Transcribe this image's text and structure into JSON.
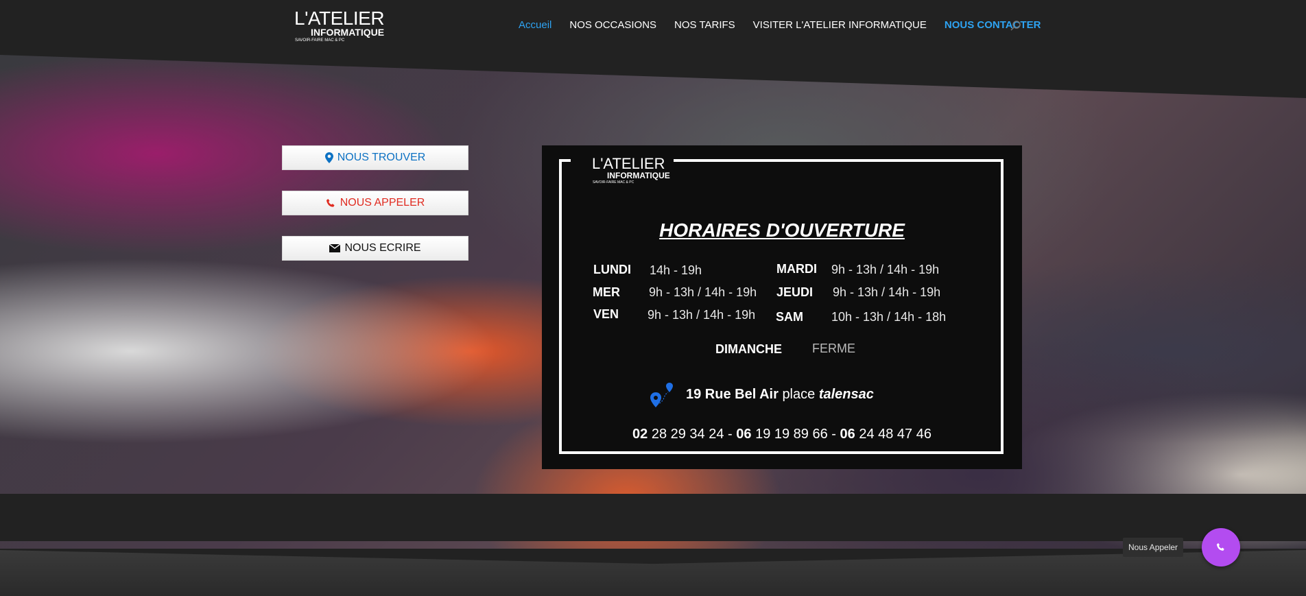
{
  "header": {
    "logo": {
      "line1": "L'ATELIER",
      "line2": "INFORMATIQUE",
      "line3": "SAVOIR-FAIRE MAC & PC"
    },
    "nav": [
      {
        "label": "Accueil"
      },
      {
        "label": "NOS OCCASIONS"
      },
      {
        "label": "NOS TARIFS"
      },
      {
        "label": "VISITER L'ATELIER INFORMATIQUE"
      },
      {
        "label": "NOUS CONTACTER"
      }
    ],
    "search_icon": "search-icon"
  },
  "cta": {
    "find": {
      "label": "NOUS TROUVER",
      "icon": "map-pin-icon",
      "color": "#0c71c3"
    },
    "call": {
      "label": "NOUS APPELER",
      "icon": "phone-icon",
      "color": "#e02b20"
    },
    "write": {
      "label": "NOUS ECRIRE",
      "icon": "envelope-icon",
      "color": "#111111"
    }
  },
  "schedule": {
    "logo": {
      "line1": "L'ATELIER",
      "line2": "INFORMATIQUE",
      "line3": "SAVOIR-FAIRE MAC & PC"
    },
    "title": "HORAIRES D'OUVERTURE",
    "days": [
      {
        "day": "LUNDI",
        "hours": "14h - 19h"
      },
      {
        "day": "MARDI",
        "hours": "9h - 13h  /  14h - 19h"
      },
      {
        "day": "MER",
        "hours": "9h - 13h  /  14h - 19h"
      },
      {
        "day": "JEUDI",
        "hours": "9h - 13h  /  14h - 19h"
      },
      {
        "day": "VEN",
        "hours": "9h - 13h  /  14h - 19h"
      },
      {
        "day": "SAM",
        "hours": "10h - 13h  /  14h - 18h"
      },
      {
        "day": "DIMANCHE",
        "hours": "FERME"
      }
    ],
    "address": {
      "street": "19 Rue Bel Air",
      "place": "place",
      "city": "talensac"
    },
    "phones": [
      {
        "prefix": "02",
        "rest": " 28 29 34 24"
      },
      {
        "prefix": "06",
        "rest": " 19 19 89 66"
      },
      {
        "prefix": "06",
        "rest": " 24 48 47 46"
      }
    ],
    "separator": " - "
  },
  "floating_call": {
    "label": "Nous Appeler",
    "color": "#b34cf0"
  },
  "colors": {
    "accent": "#2ea3f2",
    "header_bg": "#222222"
  }
}
